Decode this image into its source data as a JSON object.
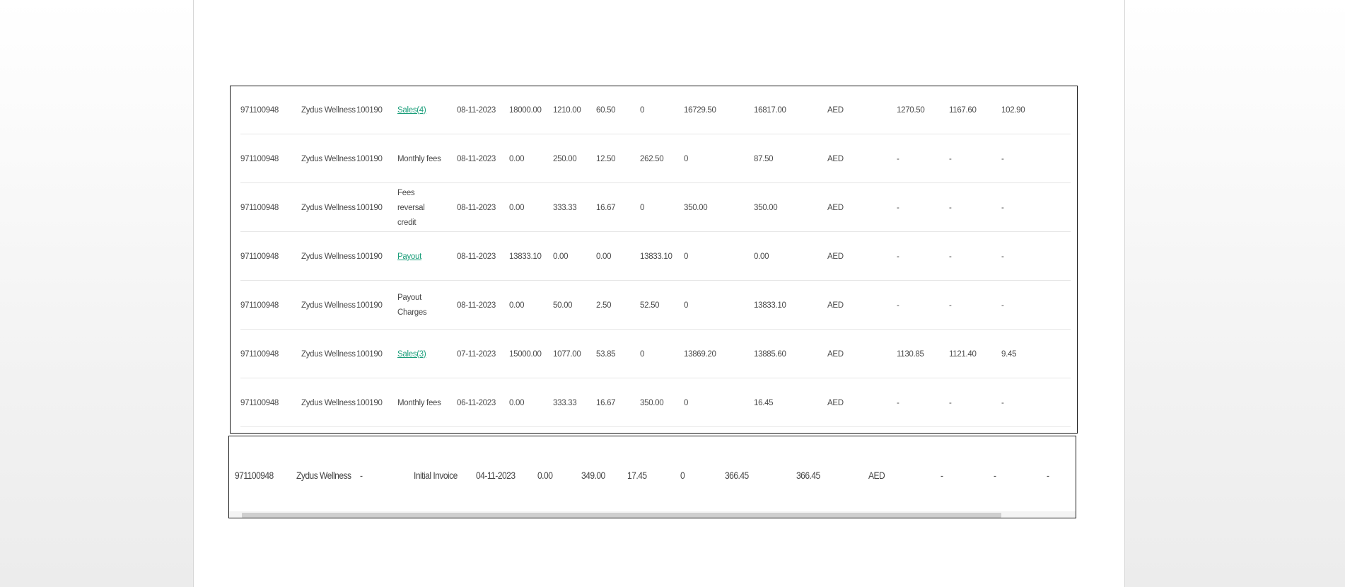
{
  "rows": [
    {
      "account": "971100948",
      "merchant": "Zydus Wellness",
      "code": "100190",
      "type": "Sales(4)",
      "type_link": true,
      "date": "08-11-2023",
      "amount": "18000.00",
      "fee": "1210.00",
      "vat": "60.50",
      "debit": "0",
      "credit": "16729.50",
      "balance": "16817.00",
      "currency": "AED",
      "c1": "1270.50",
      "c2": "1167.60",
      "c3": "102.90"
    },
    {
      "account": "971100948",
      "merchant": "Zydus Wellness",
      "code": "100190",
      "type": "Monthly fees",
      "type_link": false,
      "date": "08-11-2023",
      "amount": "0.00",
      "fee": "250.00",
      "vat": "12.50",
      "debit": "262.50",
      "credit": "0",
      "balance": "87.50",
      "currency": "AED",
      "c1": "-",
      "c2": "-",
      "c3": "-"
    },
    {
      "account": "971100948",
      "merchant": "Zydus Wellness",
      "code": "100190",
      "type": "Fees reversal credit",
      "type_link": false,
      "date": "08-11-2023",
      "amount": "0.00",
      "fee": "333.33",
      "vat": "16.67",
      "debit": "0",
      "credit": "350.00",
      "balance": "350.00",
      "currency": "AED",
      "c1": "-",
      "c2": "-",
      "c3": "-"
    },
    {
      "account": "971100948",
      "merchant": "Zydus Wellness",
      "code": "100190",
      "type": "Payout",
      "type_link": true,
      "date": "08-11-2023",
      "amount": "13833.10",
      "fee": "0.00",
      "vat": "0.00",
      "debit": "13833.10",
      "credit": "0",
      "balance": "0.00",
      "currency": "AED",
      "c1": "-",
      "c2": "-",
      "c3": "-"
    },
    {
      "account": "971100948",
      "merchant": "Zydus Wellness",
      "code": "100190",
      "type": "Payout Charges",
      "type_link": false,
      "date": "08-11-2023",
      "amount": "0.00",
      "fee": "50.00",
      "vat": "2.50",
      "debit": "52.50",
      "credit": "0",
      "balance": "13833.10",
      "currency": "AED",
      "c1": "-",
      "c2": "-",
      "c3": "-"
    },
    {
      "account": "971100948",
      "merchant": "Zydus Wellness",
      "code": "100190",
      "type": "Sales(3)",
      "type_link": true,
      "date": "07-11-2023",
      "amount": "15000.00",
      "fee": "1077.00",
      "vat": "53.85",
      "debit": "0",
      "credit": "13869.20",
      "balance": "13885.60",
      "currency": "AED",
      "c1": "1130.85",
      "c2": "1121.40",
      "c3": "9.45"
    },
    {
      "account": "971100948",
      "merchant": "Zydus Wellness",
      "code": "100190",
      "type": "Monthly fees",
      "type_link": false,
      "date": "06-11-2023",
      "amount": "0.00",
      "fee": "333.33",
      "vat": "16.67",
      "debit": "350.00",
      "credit": "0",
      "balance": "16.45",
      "currency": "AED",
      "c1": "-",
      "c2": "-",
      "c3": "-"
    }
  ],
  "last_row": {
    "account": "971100948",
    "merchant": "Zydus Wellness",
    "code": "-",
    "type": "Initial Invoice",
    "date": "04-11-2023",
    "amount": "0.00",
    "fee": "349.00",
    "vat": "17.45",
    "debit": "0",
    "credit": "366.45",
    "balance": "366.45",
    "currency": "AED",
    "c1": "-",
    "c2": "-",
    "c3": "-"
  }
}
